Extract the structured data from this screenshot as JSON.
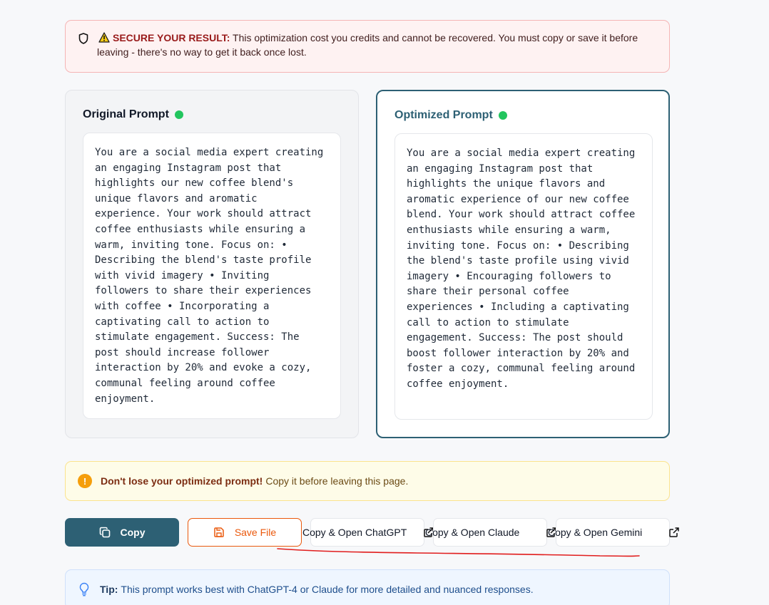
{
  "warning": {
    "title": "SECURE YOUR RESULT:",
    "message": "This optimization cost you credits and cannot be recovered. You must copy or save it before leaving - there's no way to get it back once lost."
  },
  "original": {
    "title": "Original Prompt",
    "text": "You are a social media expert creating an engaging Instagram post that highlights our new coffee blend's unique flavors and aromatic experience. Your work should attract coffee enthusiasts while ensuring a warm, inviting tone. Focus on: • Describing the blend's taste profile with vivid imagery • Inviting followers to share their experiences with coffee • Incorporating a captivating call to action to stimulate engagement. Success: The post should increase follower interaction by 20% and evoke a cozy, communal feeling around coffee enjoyment."
  },
  "optimized": {
    "title": "Optimized Prompt",
    "text": "You are a social media expert creating an engaging Instagram post that highlights the unique flavors and aromatic experience of our new coffee blend. Your work should attract coffee enthusiasts while ensuring a warm, inviting tone. Focus on: • Describing the blend's taste profile using vivid imagery • Encouraging followers to share their personal coffee experiences • Including a captivating call to action to stimulate engagement. Success: The post should boost follower interaction by 20% and foster a cozy, communal feeling around coffee enjoyment."
  },
  "reminder": {
    "bold": "Don't lose your optimized prompt!",
    "text": "Copy it before leaving this page."
  },
  "buttons": {
    "copy": "Copy",
    "save": "Save File",
    "chatgpt": "Copy & Open ChatGPT",
    "claude": "Copy & Open Claude",
    "gemini": "Copy & Open Gemini"
  },
  "tip": {
    "bold": "Tip:",
    "text": "This prompt works best with ChatGPT-4 or Claude for more detailed and nuanced responses."
  },
  "colors": {
    "primary": "#2d6074",
    "save_accent": "#ea580c",
    "status_dot": "#22c55e",
    "annotation_line": "#e11d1d"
  },
  "icons": [
    "shield-icon",
    "warning-triangle-icon",
    "status-dot",
    "exclamation-icon",
    "copy-icon",
    "save-icon",
    "external-link-icon",
    "lightbulb-icon"
  ]
}
